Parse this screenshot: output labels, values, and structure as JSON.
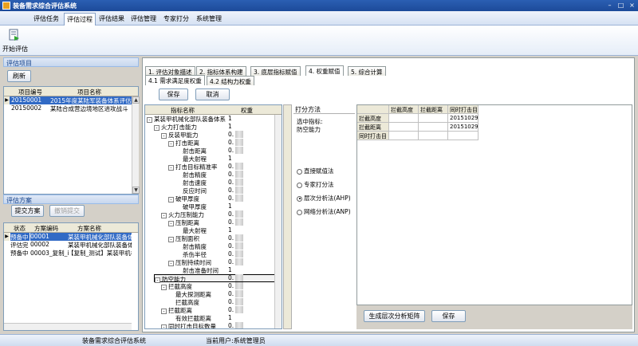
{
  "window": {
    "title": "装备需求综合评估系统"
  },
  "menu": [
    "评估任务",
    "评估过程",
    "评估结果",
    "评估管理",
    "专家打分",
    "系统管理"
  ],
  "ribbon": {
    "start_label": "开始评估"
  },
  "projects": {
    "header": "评估项目",
    "refresh_label": "刷新",
    "columns": [
      "项目编号",
      "项目名称"
    ],
    "rows": [
      {
        "id": "20150001",
        "name": "2015年度某陆军装备体系评估"
      },
      {
        "id": "20150002",
        "name": "某陆合成营边境地区进攻战斗"
      }
    ]
  },
  "schemes": {
    "header": "评估方案",
    "submit_label": "提交方案",
    "cancel_label": "撤销提交",
    "columns": [
      "状态",
      "方案编码",
      "方案名称"
    ],
    "rows": [
      {
        "status": "预备中",
        "code": "00001",
        "name": "某装甲机械化部队装备体"
      },
      {
        "status": "评估完",
        "code": "00002",
        "name": "某装甲机械化部队装备体"
      },
      {
        "status": "预备中",
        "code": "00003_复制_i",
        "name": "【复制_测试】某装甲机械"
      }
    ]
  },
  "main_tabs": [
    "1. 评估对象描述",
    "2. 指标体系构建",
    "3. 底层指标赋值",
    "4. 权重赋值",
    "5. 综合计算"
  ],
  "sub_tabs": [
    "4.1 需求满足度权重",
    "4.2 结构力权重"
  ],
  "toolbar": {
    "save_label": "保存",
    "cancel_label": "取消"
  },
  "tree": {
    "columns": [
      "指标名称",
      "权重"
    ],
    "rows": [
      {
        "label": "某装甲机械化部队装备体系",
        "weight": "1",
        "level": 0,
        "exp": "-"
      },
      {
        "label": "火力打击能力",
        "weight": "1",
        "level": 1,
        "exp": "-"
      },
      {
        "label": "反装甲能力",
        "weight": "0.",
        "level": 2,
        "exp": "-"
      },
      {
        "label": "打击距离",
        "weight": "0.",
        "level": 3,
        "exp": "-"
      },
      {
        "label": "射击距离",
        "weight": "0.",
        "level": 4,
        "exp": ""
      },
      {
        "label": "最大射程",
        "weight": "1",
        "level": 4,
        "exp": ""
      },
      {
        "label": "打击目标精准率",
        "weight": "0.",
        "level": 3,
        "exp": "-"
      },
      {
        "label": "射击精度",
        "weight": "0.",
        "level": 4,
        "exp": ""
      },
      {
        "label": "射击速度",
        "weight": "0.",
        "level": 4,
        "exp": ""
      },
      {
        "label": "反应时间",
        "weight": "0.",
        "level": 4,
        "exp": ""
      },
      {
        "label": "破甲厚度",
        "weight": "0.",
        "level": 3,
        "exp": "-"
      },
      {
        "label": "破甲厚度",
        "weight": "1",
        "level": 4,
        "exp": ""
      },
      {
        "label": "火力压制能力",
        "weight": "0.",
        "level": 2,
        "exp": "-"
      },
      {
        "label": "压制距离",
        "weight": "0.",
        "level": 3,
        "exp": "-"
      },
      {
        "label": "最大射程",
        "weight": "1",
        "level": 4,
        "exp": ""
      },
      {
        "label": "压制面积",
        "weight": "0.",
        "level": 3,
        "exp": "-"
      },
      {
        "label": "射击精度",
        "weight": "0.",
        "level": 4,
        "exp": ""
      },
      {
        "label": "杀伤半径",
        "weight": "0.",
        "level": 4,
        "exp": ""
      },
      {
        "label": "压制持续时间",
        "weight": "0.",
        "level": 3,
        "exp": "-"
      },
      {
        "label": "射击准备时间",
        "weight": "1",
        "level": 4,
        "exp": ""
      },
      {
        "label": "防空能力",
        "weight": "0.",
        "level": 1,
        "exp": "-"
      },
      {
        "label": "拦截高度",
        "weight": "0.",
        "level": 2,
        "exp": "-"
      },
      {
        "label": "最大探测距离",
        "weight": "0.",
        "level": 3,
        "exp": ""
      },
      {
        "label": "拦截高度",
        "weight": "0.",
        "level": 3,
        "exp": ""
      },
      {
        "label": "拦截距离",
        "weight": "0.",
        "level": 2,
        "exp": "-"
      },
      {
        "label": "有效拦截距离",
        "weight": "1",
        "level": 3,
        "exp": ""
      },
      {
        "label": "同时打击目标数量",
        "weight": "0.",
        "level": 2,
        "exp": "-"
      }
    ]
  },
  "method": {
    "header": "打分方法",
    "selected_label": "选中指标:",
    "selected_value": "防空能力",
    "options": [
      "直接赋值法",
      "专家打分法",
      "层次分析法(AHP)",
      "网络分析法(ANP)"
    ],
    "selected_index": 2
  },
  "matrix": {
    "columns": [
      "拦截高度",
      "拦截距离",
      "同时打击目"
    ],
    "rows": [
      {
        "label": "拦截高度",
        "cells": [
          "",
          "",
          "2015102921"
        ]
      },
      {
        "label": "拦截距离",
        "cells": [
          "",
          "",
          "2015102921"
        ]
      },
      {
        "label": "同时打击目",
        "cells": [
          "",
          "",
          ""
        ]
      }
    ],
    "generate_label": "生成层次分析矩阵",
    "save_label": "保存"
  },
  "status": {
    "app": "装备需求综合评估系统",
    "user": "当前用户:系统管理员"
  },
  "colors": {
    "selection": "#316ac5",
    "title_bar": "#1c4a99",
    "panel_header": "#15428b"
  }
}
